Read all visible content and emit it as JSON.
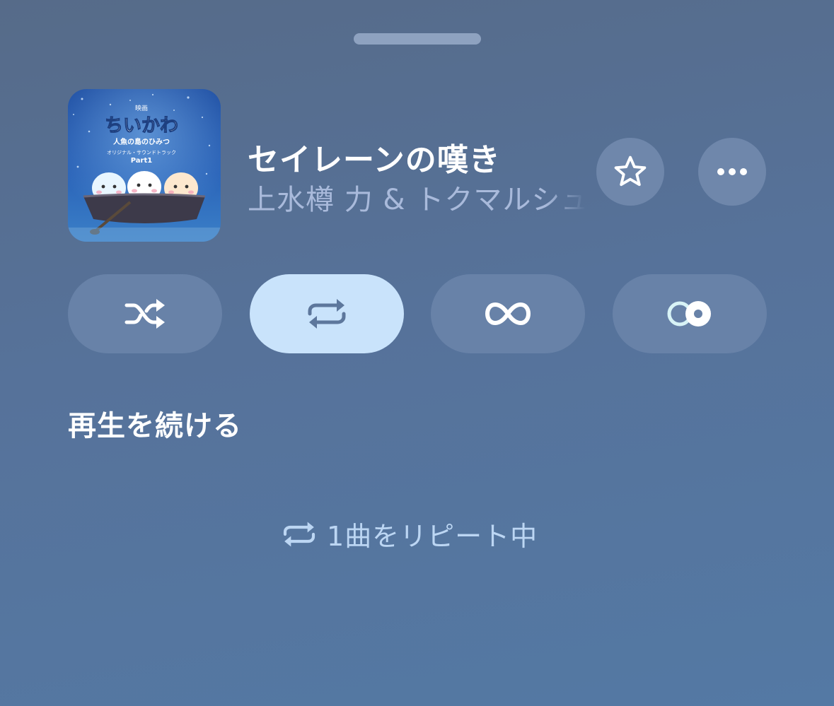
{
  "sheet": {
    "grabber": "drag-handle"
  },
  "now_playing": {
    "title": "セイレーンの嘆き",
    "artist": "上水樽 力 & トクマルシュ",
    "artwork": {
      "title_text": "ちいかわ",
      "heading_text": "映画",
      "subtitle_text": "人魚の島のひみつ",
      "caption_text": "オリジナル・サウンドトラック",
      "part_text": "Part1"
    },
    "favorite_icon": "star-outline-icon",
    "more_icon": "ellipsis-icon"
  },
  "controls": [
    {
      "id": "shuffle",
      "icon": "shuffle-icon",
      "active": false
    },
    {
      "id": "repeat",
      "icon": "repeat-icon",
      "active": true
    },
    {
      "id": "autoplay",
      "icon": "infinity-icon",
      "active": false
    },
    {
      "id": "crossfade",
      "icon": "crossfade-icon",
      "active": false
    }
  ],
  "section": {
    "heading": "再生を続ける"
  },
  "status": {
    "icon": "repeat-icon",
    "text": "1曲をリピート中"
  },
  "colors": {
    "active_pill": "#c9e3fb",
    "status_text": "#bcd6f3"
  }
}
